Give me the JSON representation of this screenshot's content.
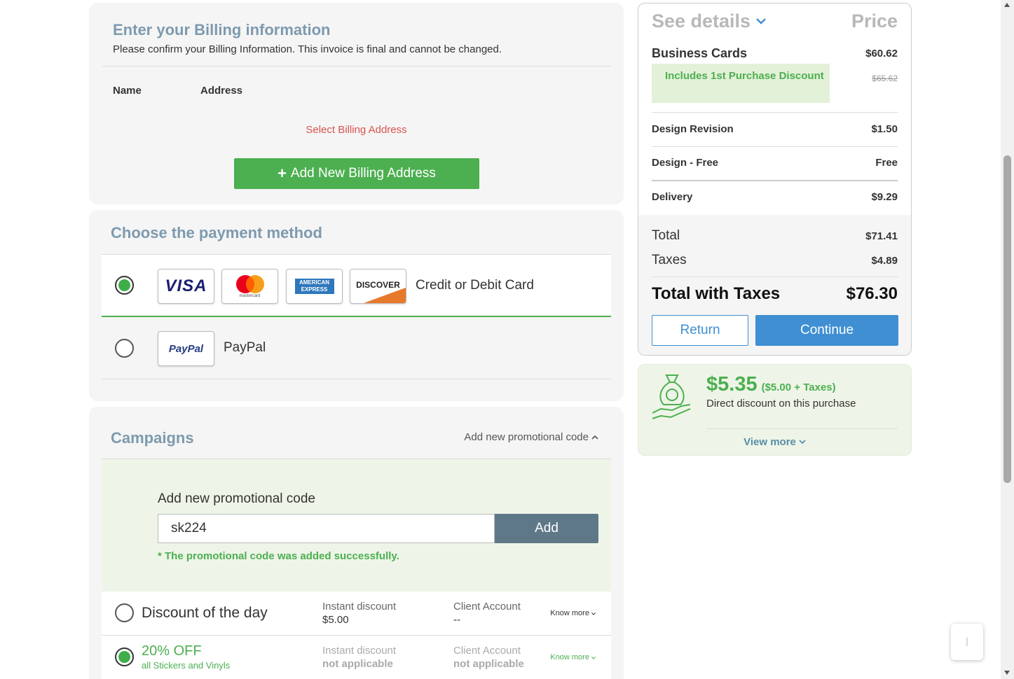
{
  "billing": {
    "title": "Enter your Billing information",
    "subtitle": "Please confirm your Billing Information. This invoice is final and cannot be changed.",
    "col_name": "Name",
    "col_address": "Address",
    "select_prompt": "Select Billing Address",
    "add_button": "Add New Billing Address"
  },
  "payment": {
    "title": "Choose the payment method",
    "card_label": "Credit or Debit Card",
    "paypal_label": "PayPal",
    "selected": "card",
    "logos": {
      "visa": "VISA",
      "mastercard": "mastercard",
      "amex_line1": "AMERICAN",
      "amex_line2": "EXPRESS",
      "discover": "DISCOVER",
      "paypal": "PayPal"
    }
  },
  "campaigns": {
    "title": "Campaigns",
    "toggle_label": "Add new promotional code",
    "promo_label": "Add new promotional code",
    "promo_value": "sk224",
    "add_button": "Add",
    "success_msg": "* The promotional code was added successfully.",
    "rows": [
      {
        "title": "Discount of the day",
        "subtitle": "",
        "instant_key": "Instant discount",
        "instant_val": "$5.00",
        "client_key": "Client Account",
        "client_val": "--",
        "know_more": "Know more",
        "selected": false
      },
      {
        "title": "20% OFF",
        "subtitle": "all Stickers and Vinyls",
        "instant_key": "Instant discount",
        "instant_val": "not applicable",
        "client_key": "Client Account",
        "client_val": "not applicable",
        "know_more": "Know more",
        "selected": true
      }
    ]
  },
  "summary": {
    "see_details": "See details",
    "price_header": "Price",
    "items": [
      {
        "label": "Business Cards",
        "value": "$60.62"
      },
      {
        "label": "Design Revision",
        "value": "$1.50"
      },
      {
        "label": "Design - Free",
        "value": "Free"
      },
      {
        "label": "Delivery",
        "value": "$9.29"
      }
    ],
    "discount_badge": "Includes 1st Purchase Discount",
    "old_price": "$65.62",
    "total_label": "Total",
    "total_value": "$71.41",
    "taxes_label": "Taxes",
    "taxes_value": "$4.89",
    "grand_label": "Total with Taxes",
    "grand_value": "$76.30",
    "return_button": "Return",
    "continue_button": "Continue"
  },
  "discount_card": {
    "amount": "$5.35",
    "breakdown": "($5.00 + Taxes)",
    "description": "Direct discount on this purchase",
    "view_more": "View more"
  },
  "colors": {
    "accent_green": "#4caf50",
    "accent_blue": "#3f8fd2",
    "title_slate": "#7d9aaf",
    "error_red": "#d9534f"
  },
  "icons": [
    "plus-icon",
    "chevron-down-icon",
    "chevron-up-icon",
    "money-bag-hand-icon"
  ]
}
